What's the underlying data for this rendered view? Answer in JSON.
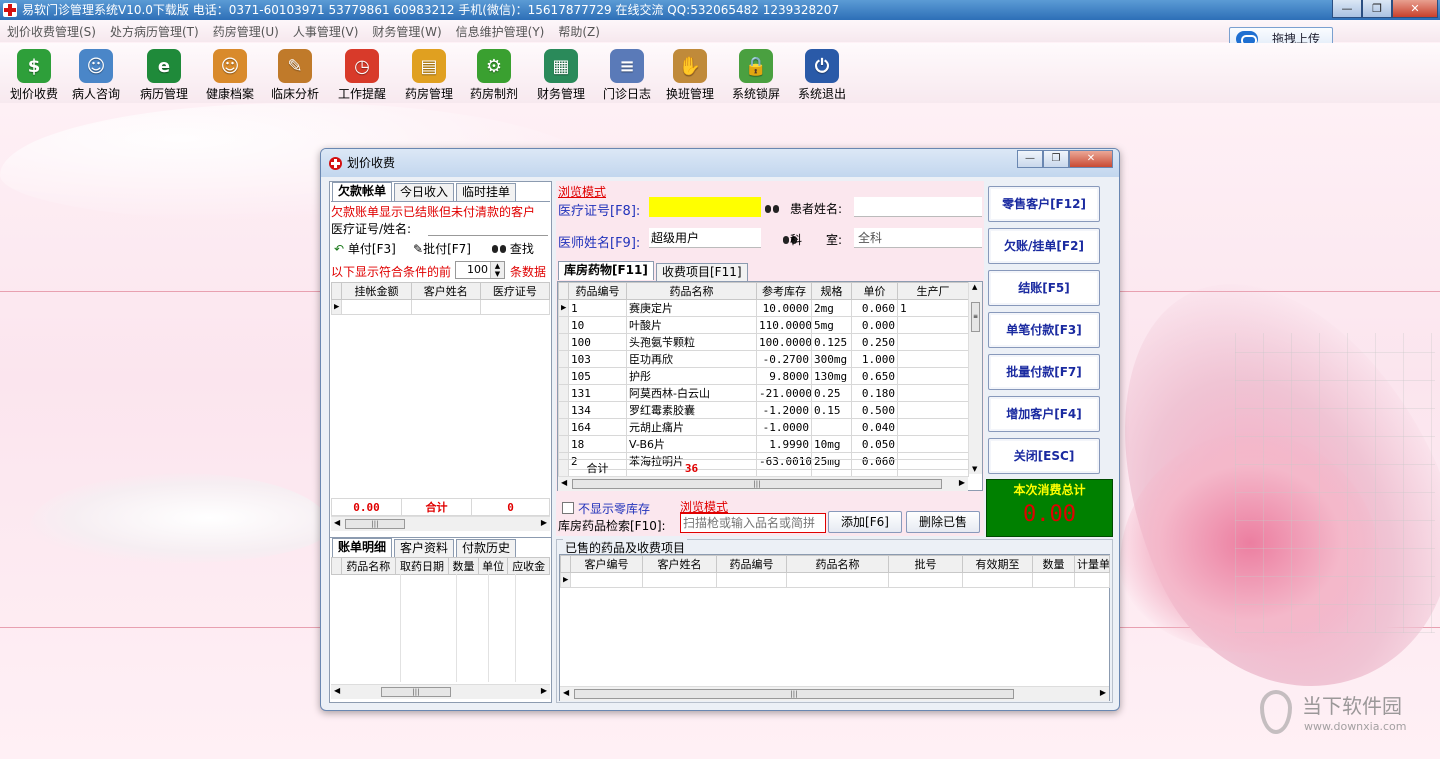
{
  "window": {
    "title": "易软门诊管理系统V10.0下载版  电话：0371-60103971 53779861 60983212 手机(微信)：15617877729  在线交流 QQ:532065482 1239328207",
    "controls": [
      "—",
      "❐",
      "✕"
    ]
  },
  "menu": [
    "划价收费管理(S)",
    "处方病历管理(T)",
    "药房管理(U)",
    "人事管理(V)",
    "财务管理(W)",
    "信息维护管理(Y)",
    "帮助(Z)"
  ],
  "upload_button": "拖拽上传",
  "toolbar": [
    {
      "label": "划价收费",
      "icon": "cash-register-icon",
      "color": "#2e9f3a",
      "glyph": "$"
    },
    {
      "label": "病人咨询",
      "icon": "doctor-icon",
      "color": "#4a86c8",
      "glyph": "☺"
    },
    {
      "label": "病历管理",
      "icon": "book-icon",
      "color": "#1f8a3a",
      "glyph": "e"
    },
    {
      "label": "健康档案",
      "icon": "health-person-icon",
      "color": "#d98a2b",
      "glyph": "☺"
    },
    {
      "label": "临床分析",
      "icon": "clipboard-icon",
      "color": "#c07a2a",
      "glyph": "✎"
    },
    {
      "label": "工作提醒",
      "icon": "alarm-clock-icon",
      "color": "#d83a2a",
      "glyph": "◷"
    },
    {
      "label": "药房管理",
      "icon": "folder-icon",
      "color": "#e0a020",
      "glyph": "▤"
    },
    {
      "label": "药房制剂",
      "icon": "gear-icon",
      "color": "#3aa030",
      "glyph": "⚙"
    },
    {
      "label": "财务管理",
      "icon": "ledger-icon",
      "color": "#2a8a5a",
      "glyph": "▦"
    },
    {
      "label": "门诊日志",
      "icon": "document-icon",
      "color": "#5a7ab8",
      "glyph": "≡"
    },
    {
      "label": "换班管理",
      "icon": "handshake-icon",
      "color": "#c08a3a",
      "glyph": "✋"
    },
    {
      "label": "系统锁屏",
      "icon": "lock-user-icon",
      "color": "#4aa040",
      "glyph": "🔒"
    },
    {
      "label": "系统退出",
      "icon": "power-icon",
      "color": "#2a5aa8",
      "glyph": "⏻"
    }
  ],
  "dialog": {
    "title": "划价收费",
    "left": {
      "tabs": [
        "欠款帐单",
        "今日收入",
        "临时挂单"
      ],
      "notice": "欠款账单显示已结账但未付清款的客户",
      "search_label": "医疗证号/姓名:",
      "actions": [
        "单付[F3]",
        "批付[F7]",
        "查找"
      ],
      "filter_prefix": "以下显示符合条件的前",
      "filter_count": "100",
      "filter_suffix": "条数据",
      "columns": [
        "挂帐金额",
        "客户姓名",
        "医疗证号"
      ],
      "totals": {
        "amount": "0.00",
        "label": "合计",
        "count": "0"
      },
      "bottom_tabs": [
        "账单明细",
        "客户资料",
        "付款历史"
      ],
      "bottom_columns": [
        "药品名称",
        "取药日期",
        "数量",
        "单位",
        "应收金"
      ]
    },
    "center": {
      "mode_label": "浏览模式",
      "card_label": "医疗证号[F8]:",
      "card_value": "",
      "patient_label": "患者姓名:",
      "patient_value": "",
      "doctor_label": "医师姓名[F9]:",
      "doctor_value": "超级用户",
      "dept_label": "科　　室:",
      "dept_value": "全科",
      "tabs": [
        "库房药物[F11]",
        "收费项目[F11]"
      ],
      "columns": [
        "药品编号",
        "药品名称",
        "参考库存",
        "规格",
        "单价",
        "生产厂"
      ],
      "rows": [
        [
          "1",
          "赛庚定片",
          "10.0000",
          "2mg",
          "0.060",
          "1"
        ],
        [
          "10",
          "叶酸片",
          "110.0000",
          "5mg",
          "0.000",
          ""
        ],
        [
          "100",
          "头孢氨苄颗粒",
          "100.0000",
          "0.125",
          "0.250",
          ""
        ],
        [
          "103",
          "臣功再欣",
          "-0.2700",
          "300mg",
          "1.000",
          ""
        ],
        [
          "105",
          "护彤",
          "9.8000",
          "130mg",
          "0.650",
          ""
        ],
        [
          "131",
          "阿莫西林-白云山",
          "-21.0000",
          "0.25",
          "0.180",
          ""
        ],
        [
          "134",
          "罗红霉素胶囊",
          "-1.2000",
          "0.15",
          "0.500",
          ""
        ],
        [
          "164",
          "元胡止痛片",
          "-1.0000",
          "",
          "0.040",
          ""
        ],
        [
          "18",
          "V-B6片",
          "1.9990",
          "10mg",
          "0.050",
          ""
        ],
        [
          "2",
          "苯海拉明片",
          "-63.0010",
          "25mg",
          "0.060",
          ""
        ]
      ],
      "total_label": "合计",
      "total_count": "36",
      "hide_zero_label": "不显示零库存",
      "search_mode": "浏览模式",
      "search_label": "库房药品检索[F10]:",
      "search_placeholder": "扫描枪或输入品名或简拼",
      "add_button": "添加[F6]",
      "delete_button": "删除已售",
      "sold_title": "已售的药品及收费项目",
      "sold_columns": [
        "客户编号",
        "客户姓名",
        "药品编号",
        "药品名称",
        "批号",
        "有效期至",
        "数量",
        "计量单"
      ]
    },
    "right": {
      "buttons": [
        "零售客户[F12]",
        "欠账/挂单[F2]",
        "结账[F5]",
        "单笔付款[F3]",
        "批量付款[F7]",
        "增加客户[F4]",
        "关闭[ESC]"
      ],
      "total_title": "本次消费总计",
      "total_value": "0.00"
    }
  },
  "watermark": {
    "name": "当下软件园",
    "url": "www.downxia.com"
  }
}
